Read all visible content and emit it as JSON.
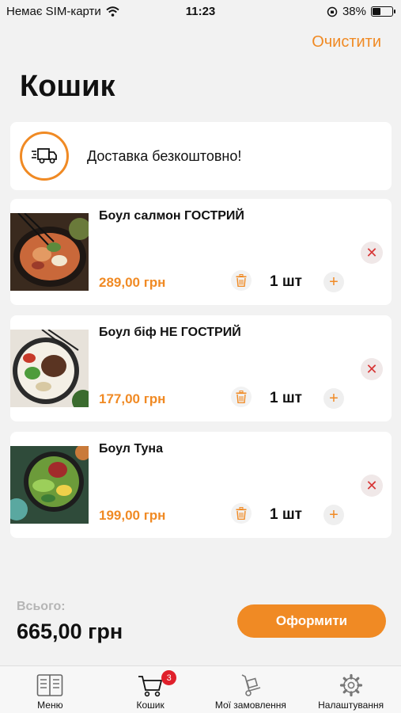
{
  "status_bar": {
    "carrier": "Немає SIM-карти",
    "time": "11:23",
    "battery": "38%",
    "battery_level": 0.38
  },
  "header": {
    "clear_label": "Очистити",
    "title": "Кошик"
  },
  "delivery": {
    "text": "Доставка безкоштовно!",
    "icon": "delivery-truck-icon"
  },
  "cart": {
    "items": [
      {
        "name": "Боул салмон ГОСТРИЙ",
        "price": "289,00 грн",
        "quantity": "1 шт"
      },
      {
        "name": "Боул біф НЕ ГОСТРИЙ",
        "price": "177,00 грн",
        "quantity": "1 шт"
      },
      {
        "name": "Боул Туна",
        "price": "199,00 грн",
        "quantity": "1 шт"
      }
    ]
  },
  "summary": {
    "total_label": "Всього:",
    "total_value": "665,00 грн",
    "checkout_label": "Оформити"
  },
  "tabbar": {
    "tabs": [
      {
        "label": "Меню",
        "icon": "menu-book-icon"
      },
      {
        "label": "Кошик",
        "icon": "cart-icon",
        "badge": "3"
      },
      {
        "label": "Мої замовлення",
        "icon": "hand-truck-icon"
      },
      {
        "label": "Налаштування",
        "icon": "gear-icon"
      }
    ]
  },
  "colors": {
    "accent": "#f08a24",
    "remove": "#d73636",
    "badge": "#e0202b",
    "background": "#f2f2f2"
  }
}
